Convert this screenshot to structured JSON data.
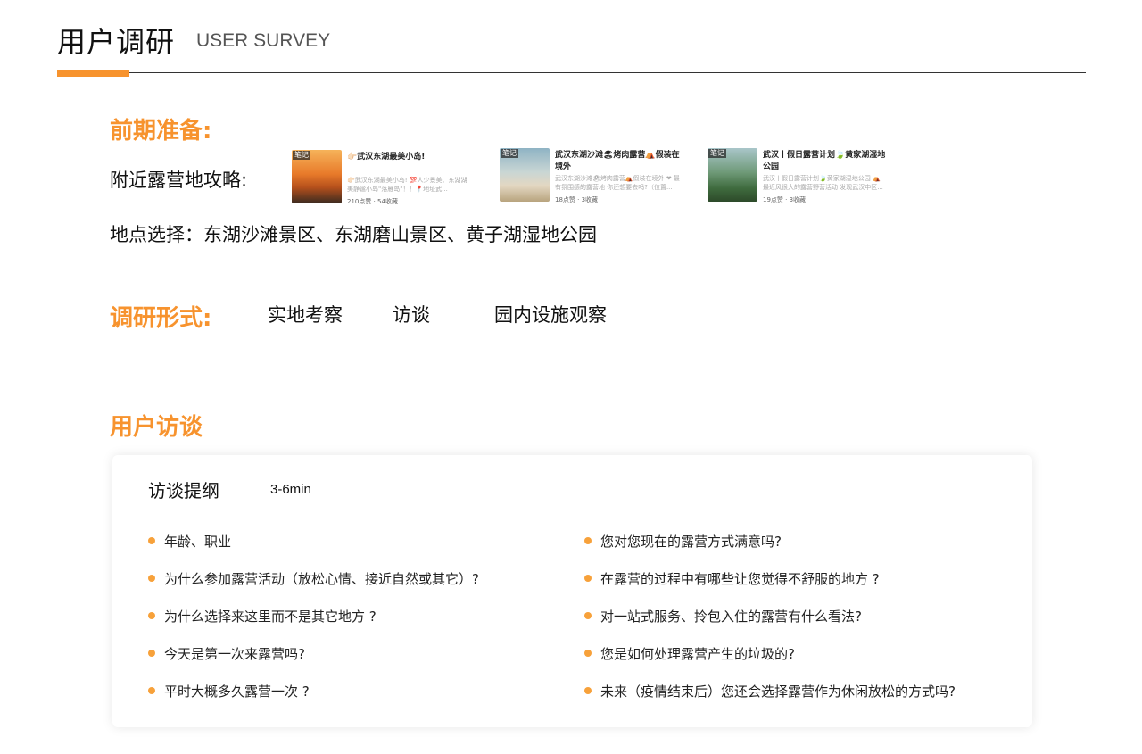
{
  "header": {
    "title_cn": "用户调研",
    "title_en": "USER SURVEY"
  },
  "colors": {
    "accent": "#f7932e",
    "bullet": "#f7a13a",
    "rule": "#333333"
  },
  "prep": {
    "heading": "前期准备:",
    "guides_label": "附近露营地攻略:",
    "location_line": "地点选择：东湖沙滩景区、东湖磨山景区、黄子湖湿地公园",
    "notes": [
      {
        "tag": "笔记",
        "title": "👉🏻武汉东湖最美小岛!",
        "desc": "👉🏻武汉东湖最美小岛! 💯人少景美、东湖湖美静谧小岛\"落雁岛\"！！📍地址武...",
        "stats": "210点赞 · 54收藏"
      },
      {
        "tag": "笔记",
        "title": "武汉东湖沙滩🏖烤肉露营⛺假装在境外",
        "desc": "武汉东湖沙滩🏖烤肉露营⛺假装在境外 ❤ 最有氛围感的露营地 你还想要去吗?（位置...",
        "stats": "18点赞 · 3收藏"
      },
      {
        "tag": "笔记",
        "title": "武汉丨假日露营计划🍃黄家湖湿地公园",
        "desc": "武汉丨假日露营计划🍃黄家湖湿地公园 ⛺ 最近风很大的露营野营活动 发现武汉中区...",
        "stats": "19点赞 · 3收藏"
      }
    ]
  },
  "methods": {
    "heading": "调研形式:",
    "items": [
      "实地考察",
      "访谈",
      "园内设施观察"
    ]
  },
  "interview": {
    "heading": "用户访谈",
    "card_title": "访谈提纲",
    "duration": "3-6min",
    "left": [
      "年龄、职业",
      "为什么参加露营活动（放松心情、接近自然或其它）?",
      "为什么选择来这里而不是其它地方 ?",
      "今天是第一次来露营吗?",
      "平时大概多久露营一次 ?"
    ],
    "right": [
      "您对您现在的露营方式满意吗?",
      "在露营的过程中有哪些让您觉得不舒服的地方 ?",
      "对一站式服务、拎包入住的露营有什么看法?",
      "您是如何处理露营产生的垃圾的?",
      "未来（疫情结束后）您还会选择露营作为休闲放松的方式吗?"
    ]
  }
}
